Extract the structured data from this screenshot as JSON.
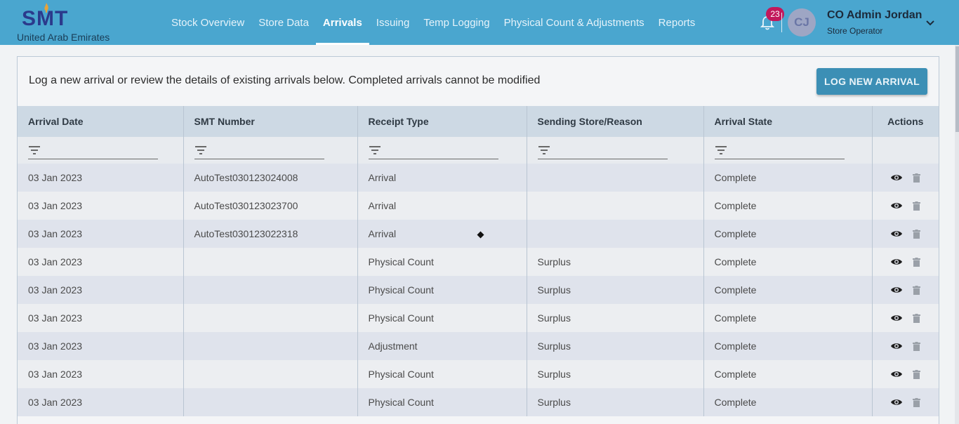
{
  "header": {
    "logo_text": "SMT",
    "country": "United Arab Emirates",
    "nav": [
      {
        "label": "Stock Overview"
      },
      {
        "label": "Store Data"
      },
      {
        "label": "Arrivals"
      },
      {
        "label": "Issuing"
      },
      {
        "label": "Temp Logging"
      },
      {
        "label": "Physical Count & Adjustments"
      },
      {
        "label": "Reports"
      }
    ],
    "active_nav": "Arrivals",
    "notification_count": "23",
    "avatar_initials": "CJ",
    "user_name": "CO Admin Jordan",
    "user_role": "Store Operator"
  },
  "main": {
    "intro_text": "Log a new arrival or review the details of existing arrivals below. Completed arrivals cannot be modified",
    "log_new_button": "LOG NEW ARRIVAL",
    "columns": [
      "Arrival Date",
      "SMT Number",
      "Receipt Type",
      "Sending Store/Reason",
      "Arrival State",
      "Actions"
    ],
    "rows": [
      {
        "date": "03 Jan 2023",
        "smt": "AutoTest030123024008",
        "type": "Arrival",
        "reason": "",
        "state": "Complete"
      },
      {
        "date": "03 Jan 2023",
        "smt": "AutoTest030123023700",
        "type": "Arrival",
        "reason": "",
        "state": "Complete"
      },
      {
        "date": "03 Jan 2023",
        "smt": "AutoTest030123022318",
        "type": "Arrival",
        "reason": "",
        "state": "Complete"
      },
      {
        "date": "03 Jan 2023",
        "smt": "",
        "type": "Physical Count",
        "reason": "Surplus",
        "state": "Complete"
      },
      {
        "date": "03 Jan 2023",
        "smt": "",
        "type": "Physical Count",
        "reason": "Surplus",
        "state": "Complete"
      },
      {
        "date": "03 Jan 2023",
        "smt": "",
        "type": "Physical Count",
        "reason": "Surplus",
        "state": "Complete"
      },
      {
        "date": "03 Jan 2023",
        "smt": "",
        "type": "Adjustment",
        "reason": "Surplus",
        "state": "Complete"
      },
      {
        "date": "03 Jan 2023",
        "smt": "",
        "type": "Physical Count",
        "reason": "Surplus",
        "state": "Complete"
      },
      {
        "date": "03 Jan 2023",
        "smt": "",
        "type": "Physical Count",
        "reason": "Surplus",
        "state": "Complete"
      }
    ]
  },
  "icons": {
    "notifications": "bell-icon",
    "account_menu": "chevron-down-icon",
    "filter": "filter-icon",
    "view": "eye-icon",
    "delete": "trash-icon"
  },
  "colors": {
    "header_bg": "#4aa6cf",
    "logo": "#2b3a8c",
    "badge": "#c2185b",
    "primary_button": "#3c8fb5",
    "table_header": "#cdd9e4"
  }
}
